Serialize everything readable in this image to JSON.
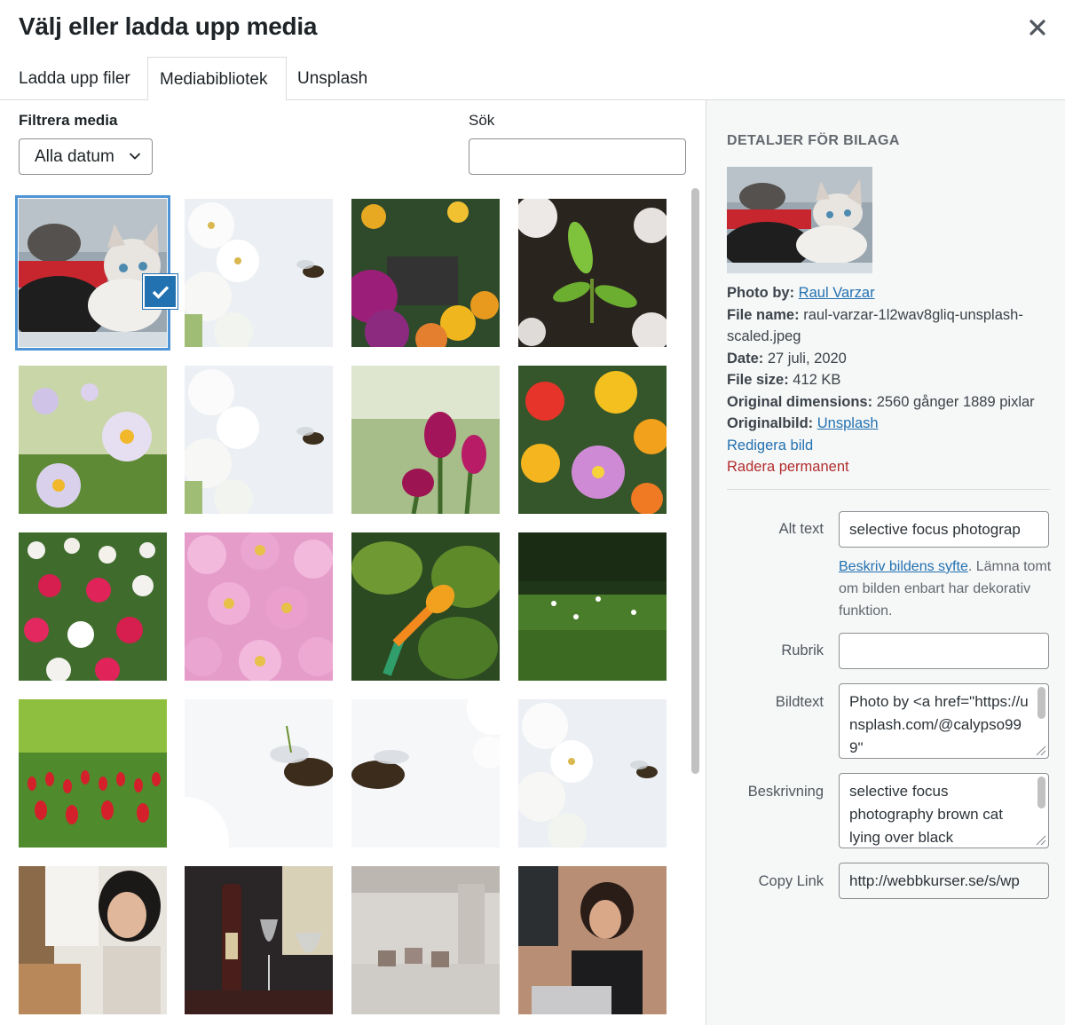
{
  "modal": {
    "title": "Välj eller ladda upp media",
    "close_icon": "close-icon"
  },
  "tabs": [
    {
      "label": "Ladda upp filer",
      "active": false
    },
    {
      "label": "Mediabibliotek",
      "active": true
    },
    {
      "label": "Unsplash",
      "active": false
    }
  ],
  "filters": {
    "filter_label": "Filtrera media",
    "date_value": "Alla datum",
    "search_label": "Sök",
    "search_value": ""
  },
  "grid": {
    "selected_index": 0,
    "items": [
      {
        "subject": "kittens-on-blanket"
      },
      {
        "subject": "bee-white-blossom"
      },
      {
        "subject": "potted-flowers"
      },
      {
        "subject": "seedling-in-soil"
      },
      {
        "subject": "purple-daisies"
      },
      {
        "subject": "bee-white-blossom"
      },
      {
        "subject": "pink-tulips"
      },
      {
        "subject": "colorful-daisies"
      },
      {
        "subject": "daisy-field"
      },
      {
        "subject": "pink-chrysanthemums"
      },
      {
        "subject": "watering-can"
      },
      {
        "subject": "grass-with-flowers"
      },
      {
        "subject": "red-tulip-field"
      },
      {
        "subject": "bee-closeup"
      },
      {
        "subject": "bee-flying"
      },
      {
        "subject": "bee-white-blossom"
      },
      {
        "subject": "woman-on-phone"
      },
      {
        "subject": "wine-bottle-glasses"
      },
      {
        "subject": "cafe-interior"
      },
      {
        "subject": "woman-with-laptop"
      }
    ]
  },
  "sidebar": {
    "heading": "Detaljer för bilaga",
    "photo_by_label": "Photo by:",
    "photo_by_value": "Raul Varzar",
    "file_name_label": "File name:",
    "file_name_value": "raul-varzar-1l2wav8gliq-unsplash-scaled.jpeg",
    "date_label": "Date:",
    "date_value": "27 juli, 2020",
    "file_size_label": "File size:",
    "file_size_value": "412 KB",
    "dimensions_label": "Original dimensions:",
    "dimensions_value": "2560 gånger 1889 pixlar",
    "original_label": "Originalbild:",
    "original_value": "Unsplash",
    "edit_link": "Redigera bild",
    "delete_link": "Radera permanent"
  },
  "fields": {
    "alt_label": "Alt text",
    "alt_value": "selective focus photograp",
    "alt_help_link": "Beskriv bildens syfte",
    "alt_help_text": ". Lämna tomt om bilden enbart har dekorativ funktion.",
    "title_label": "Rubrik",
    "title_value": "",
    "caption_label": "Bildtext",
    "caption_value": "Photo by <a href=\"https://unsplash.com/@calypso999\"",
    "description_label": "Beskrivning",
    "description_value": "selective focus photography brown cat lying over black",
    "copy_label": "Copy Link",
    "copy_value": "http://webbkurser.se/s/wp"
  },
  "colors": {
    "accent": "#2271b1",
    "delete": "#b32d2e",
    "sidebar_bg": "#f6f7f7"
  }
}
